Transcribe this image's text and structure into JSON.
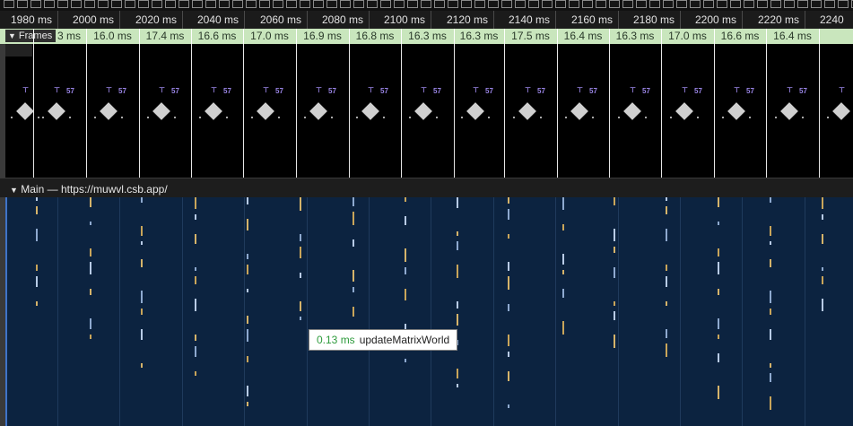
{
  "ruler": {
    "ticks": [
      "1980 ms",
      "2000 ms",
      "2020 ms",
      "2040 ms",
      "2060 ms",
      "2080 ms",
      "2100 ms",
      "2120 ms",
      "2140 ms",
      "2160 ms",
      "2180 ms",
      "2200 ms",
      "2220 ms",
      "2240"
    ]
  },
  "frames_track": {
    "label": "Frames",
    "durations": [
      "3 ms",
      "16.0 ms",
      "17.4 ms",
      "16.6 ms",
      "17.0 ms",
      "16.9 ms",
      "16.8 ms",
      "16.3 ms",
      "16.3 ms",
      "17.5 ms",
      "16.4 ms",
      "16.3 ms",
      "17.0 ms",
      "16.6 ms",
      "16.4 ms"
    ],
    "marker_label": "57"
  },
  "main_track": {
    "title": "Main — https://muwvl.csb.app/"
  },
  "tooltip": {
    "duration": "0.13 ms",
    "name": "updateMatrixWorld"
  },
  "colors": {
    "frames_bg": "#c9e6bd",
    "main_bg": "#0c2340",
    "tooltip_duration": "#2e9b3c",
    "marker_purple": "#9b86e8"
  }
}
